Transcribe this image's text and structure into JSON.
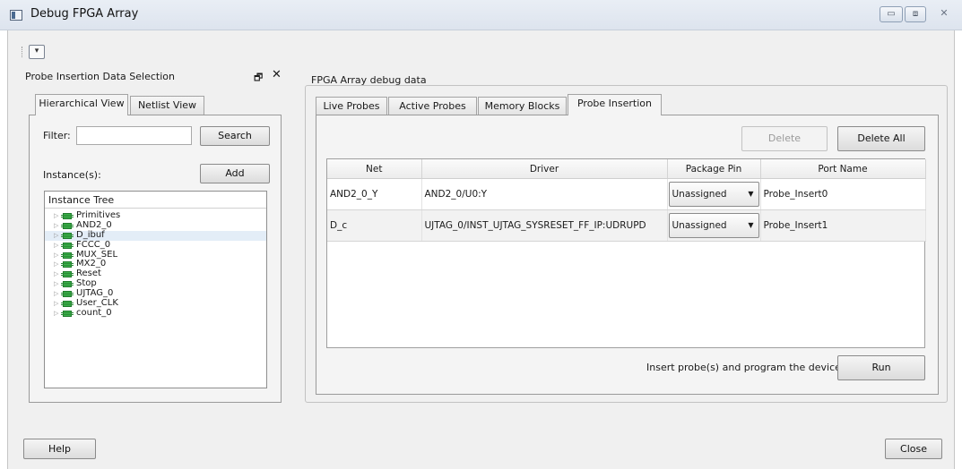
{
  "window": {
    "title": "Debug FPGA Array",
    "controls": [
      "▭",
      "⧈",
      "✕"
    ]
  },
  "left_dock": {
    "title": "Probe Insertion Data Selection",
    "float_glyph": "🗗",
    "close_glyph": "✕",
    "tabs": [
      "Hierarchical View",
      "Netlist View"
    ],
    "filter_label": "Filter:",
    "filter_value": "",
    "search_button": "Search",
    "instances_label": "Instance(s):",
    "add_button": "Add",
    "tree_header": "Instance Tree",
    "tree_items": [
      "Primitives",
      "AND2_0",
      "D_ibuf",
      "FCCC_0",
      "MUX_SEL",
      "MX2_0",
      "Reset",
      "Stop",
      "UJTAG_0",
      "User_CLK",
      "count_0"
    ],
    "selected_item": "D_ibuf"
  },
  "main": {
    "group_title": "FPGA Array debug data",
    "tabs": [
      "Live Probes",
      "Active Probes",
      "Memory Blocks",
      "Probe Insertion"
    ],
    "active_tab": "Probe Insertion",
    "delete_button": "Delete",
    "delete_all_button": "Delete All",
    "columns": [
      "Net",
      "Driver",
      "Package Pin",
      "Port Name"
    ],
    "rows": [
      {
        "net": "AND2_0_Y",
        "driver": "AND2_0/U0:Y",
        "package_pin": "Unassigned",
        "port_name": "Probe_Insert0"
      },
      {
        "net": "D_c",
        "driver": "UJTAG_0/INST_UJTAG_SYSRESET_FF_IP:UDRUPD",
        "package_pin": "Unassigned",
        "port_name": "Probe_Insert1"
      }
    ],
    "status_text": "Insert probe(s) and program the device",
    "run_button": "Run"
  },
  "footer": {
    "help_button": "Help",
    "close_button": "Close"
  },
  "colors": {
    "tree_chip": "#3bb34a",
    "title_bar": "#e4eaf2"
  }
}
